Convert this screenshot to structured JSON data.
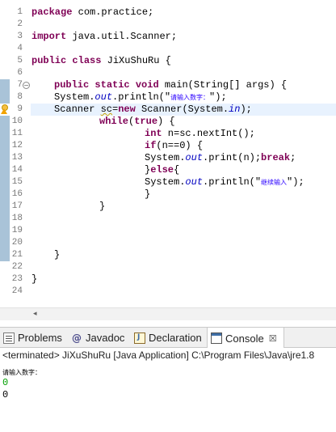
{
  "editor": {
    "line_numbers": [
      "1",
      "2",
      "3",
      "4",
      "5",
      "6",
      "7",
      "8",
      "9",
      "10",
      "11",
      "12",
      "13",
      "14",
      "15",
      "16",
      "17",
      "18",
      "19",
      "20",
      "21",
      "22",
      "23",
      "24"
    ],
    "code": {
      "l1_kw": "package",
      "l1_rest": " com.practice;",
      "l3_kw": "import",
      "l3_rest": " java.util.Scanner;",
      "l5_kw1": "public",
      "l5_kw2": "class",
      "l5_rest": " JiXuShuRu {",
      "l7_kw1": "public",
      "l7_kw2": "static",
      "l7_kw3": "void",
      "l7_rest": " main(String[] args) {",
      "l8_a": "System.",
      "l8_out": "out",
      "l8_b": ".println(\"",
      "l8_str": "请输入数字：",
      "l8_c": "\");",
      "l9_a": "Scanner ",
      "l9_var": "sc",
      "l9_eq": "=",
      "l9_kw": "new",
      "l9_b": " Scanner(System.",
      "l9_in": "in",
      "l9_c": ");",
      "l10_kw1": "while",
      "l10_paren": "(",
      "l10_kw2": "true",
      "l10_rest": ") {",
      "l11_kw": "int",
      "l11_rest": " n=sc.nextInt();",
      "l12_kw": "if",
      "l12_rest": "(n==0) {",
      "l13_a": "System.",
      "l13_out": "out",
      "l13_b": ".print(n);",
      "l13_kw": "break",
      "l13_c": ";",
      "l14_a": "}",
      "l14_kw": "else",
      "l14_b": "{",
      "l15_a": "System.",
      "l15_out": "out",
      "l15_b": ".println(\"",
      "l15_str": "继续输入",
      "l15_c": "\");",
      "l16": "}",
      "l17": "}",
      "l21": "}",
      "l23": "}"
    },
    "fold_symbol": "−"
  },
  "scrollbar": {
    "left_arrow": "◂"
  },
  "tabs": [
    {
      "label": "Problems",
      "icon": "problems-icon"
    },
    {
      "label": "Javadoc",
      "icon": "javadoc-icon",
      "glyph": "@"
    },
    {
      "label": "Declaration",
      "icon": "declaration-icon"
    },
    {
      "label": "Console",
      "icon": "console-icon",
      "close": "☒"
    }
  ],
  "console": {
    "terminated": "<terminated> JiXuShuRu [Java Application] C:\\Program Files\\Java\\jre1.8",
    "lines": [
      "请输入数字：",
      "0",
      "0"
    ]
  },
  "colors": {
    "keyword": "#7f0055",
    "field": "#0000c0",
    "string": "#2a00ff",
    "line_highlight": "#e8f2fe",
    "console_input": "#00a000"
  }
}
